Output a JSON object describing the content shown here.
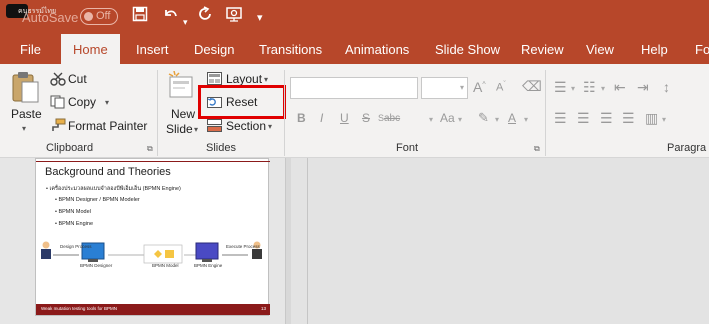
{
  "titlebar": {
    "logo_text": "คนธรรม์ไทย",
    "autosave_label": "AutoSave",
    "toggle_state": "Off",
    "icons": [
      "save-icon",
      "undo-icon",
      "redo-icon",
      "present-icon",
      "customize-icon"
    ]
  },
  "tabs": [
    "File",
    "Home",
    "Insert",
    "Design",
    "Transitions",
    "Animations",
    "Slide Show",
    "Review",
    "View",
    "Help",
    "Fo:"
  ],
  "active_tab": "Home",
  "ribbon": {
    "clipboard": {
      "paste": "Paste",
      "cut": "Cut",
      "copy": "Copy",
      "format_painter": "Format Painter",
      "group_label": "Clipboard"
    },
    "slides": {
      "new_slide_line1": "New",
      "new_slide_line2": "Slide",
      "layout": "Layout",
      "reset": "Reset",
      "section": "Section",
      "group_label": "Slides"
    },
    "font": {
      "font_name_value": "",
      "font_size_value": "",
      "bold": "B",
      "italic": "I",
      "underline": "U",
      "strikethrough": "S",
      "char_spacing": "abc",
      "change_case": "Aa",
      "group_label": "Font"
    },
    "paragraph": {
      "group_label": "Paragra"
    }
  },
  "slide_thumb": {
    "title": "Background and Theories",
    "bullet_main": "• เครื่องประมวลผลแบบจำลองบีพีเอ็มเอ็น (BPMN Engine)",
    "sub_bullets": [
      "• BPMN Designer / BPMN Modeler",
      "• BPMN Model",
      "• BPMN Engine"
    ],
    "diagram_labels": {
      "design_process": "Design Process",
      "bpmn_designer": "BPMN Designer",
      "bpmn_model": "BPMN Model",
      "bpmn_engine": "BPMN Engine",
      "execute_process": "Execute Process"
    },
    "footer_text": "Weak mutation testing tools for BPMN",
    "footer_number": "13"
  },
  "colors": {
    "accent": "#b7472a",
    "ribbon_bg": "#f3f2f1",
    "highlight": "#e00000",
    "slide_accent": "#8b1a1a"
  }
}
